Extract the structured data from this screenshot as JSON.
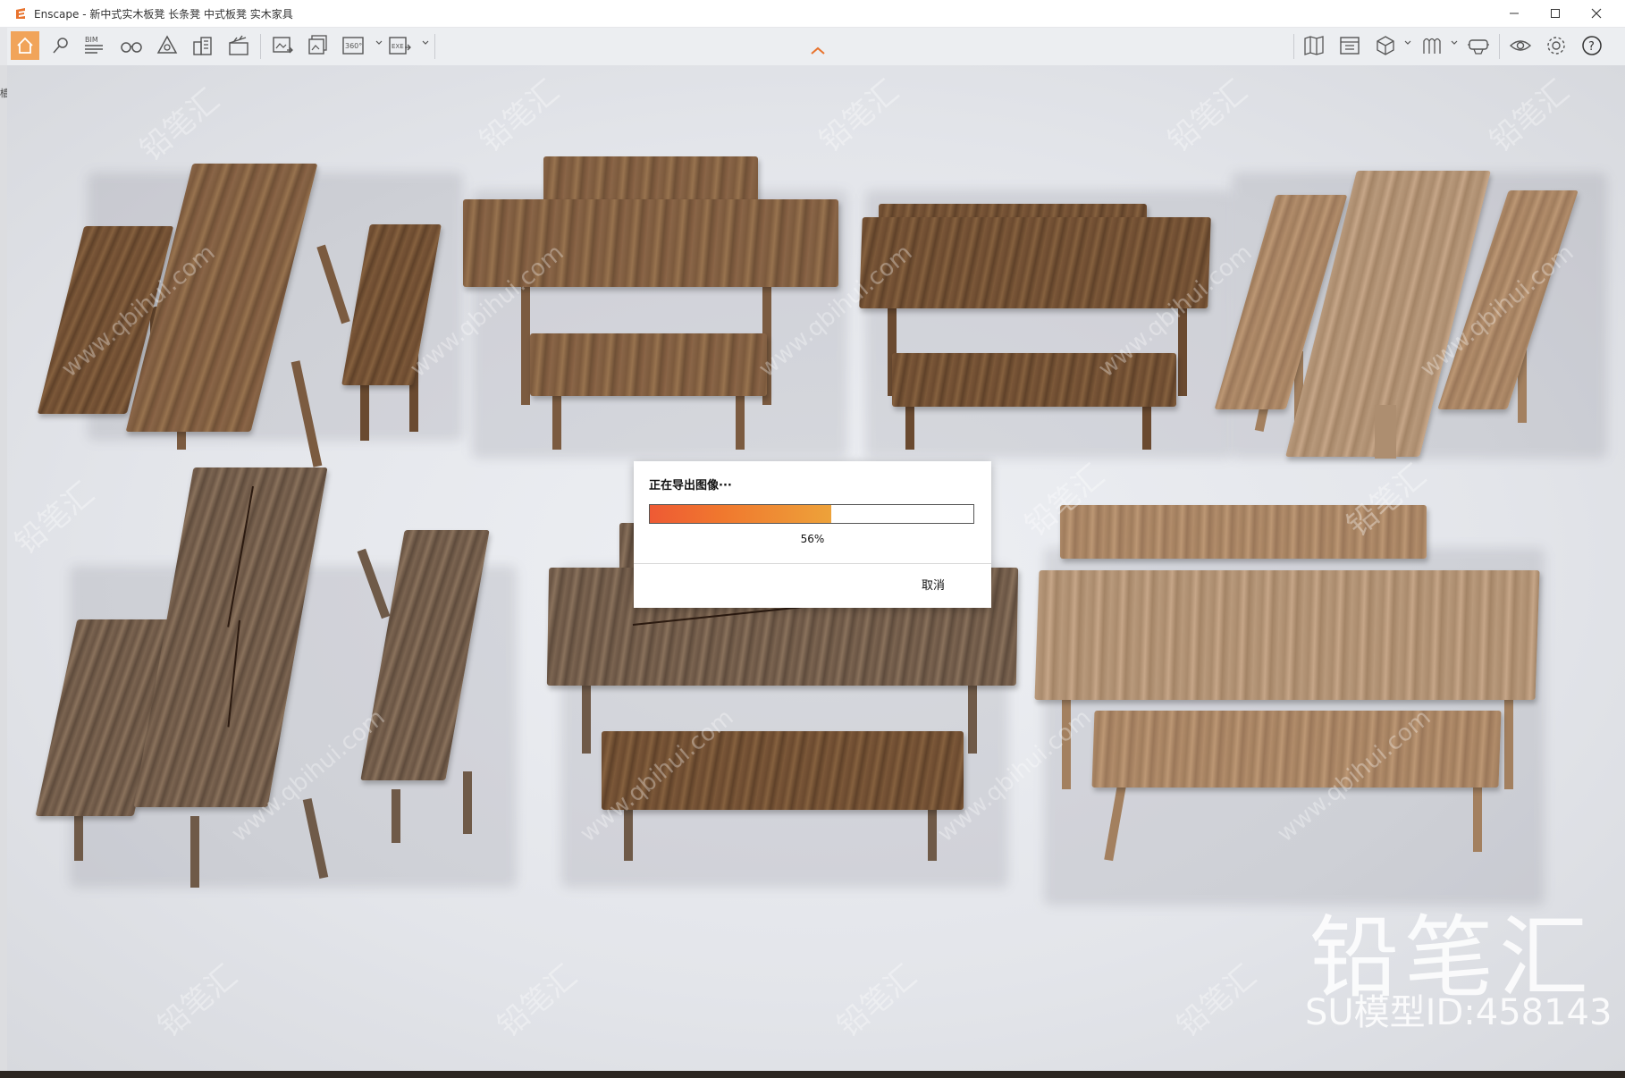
{
  "window": {
    "app_name": "Enscape",
    "title": "新中式实木板凳 长条凳 中式板凳 实木家具",
    "brand_color": "#e8732e"
  },
  "toolbar": {
    "left_icons": [
      "home-icon",
      "location-pin-icon",
      "bim-icon",
      "binoculars-icon",
      "perspective-icon",
      "buildings-icon",
      "clapperboard-icon",
      "render-image-icon",
      "batch-render-icon",
      "panorama-360-icon",
      "export-exe-icon"
    ],
    "bim_label": "BIM",
    "pano_label": "360°",
    "exe_label": "EXE",
    "right_icons": [
      "map-icon",
      "asset-library-icon",
      "view-cube-icon",
      "materials-icon",
      "vr-headset-icon",
      "visual-settings-icon",
      "settings-gear-icon",
      "help-icon"
    ],
    "help_label": "?"
  },
  "side_char": "樯",
  "dialog": {
    "title": "正在导出图像···",
    "progress": 0.56,
    "percent_label": "56%",
    "cancel_label": "取消"
  },
  "watermark": {
    "brand": "铅笔汇",
    "model_id": "SU模型ID:458143",
    "tile_text": "铅笔汇",
    "url_text": "www.qbihui.com"
  }
}
